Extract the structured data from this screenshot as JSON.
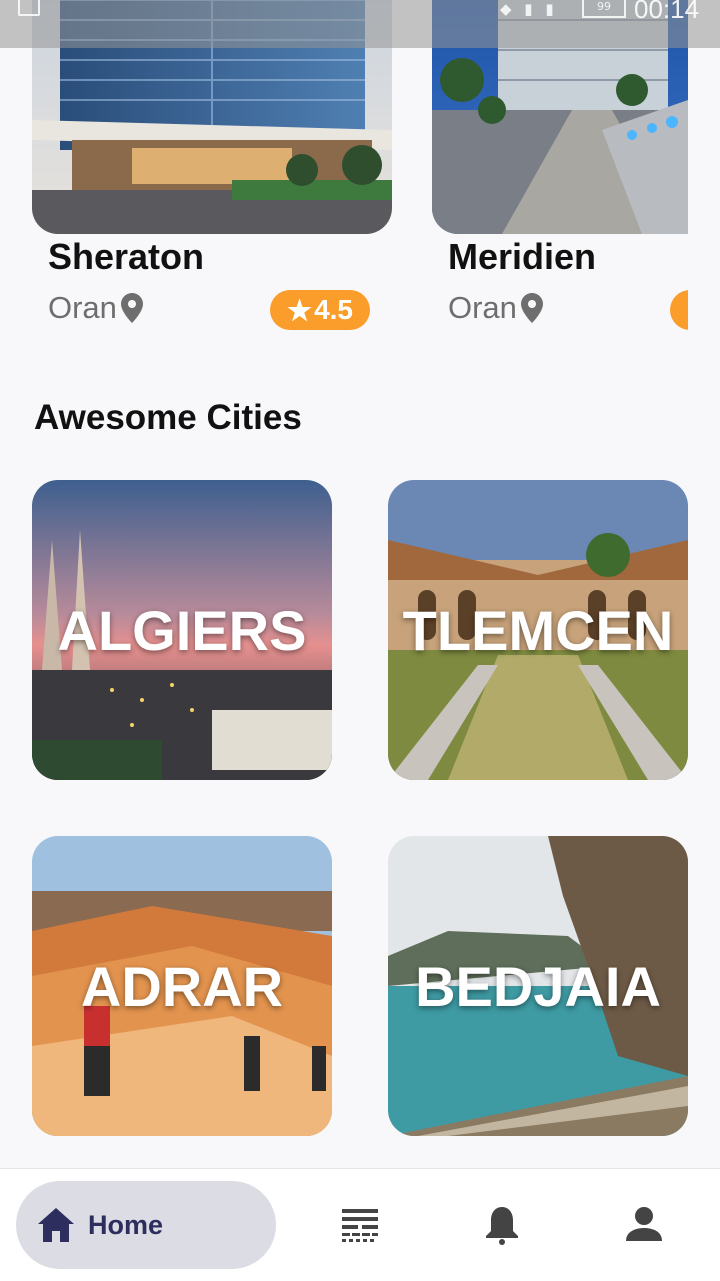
{
  "status_bar": {
    "time": "00:14",
    "battery": "99"
  },
  "hotels": [
    {
      "name": "Sheraton",
      "city": "Oran",
      "rating": "4.5"
    },
    {
      "name": "Meridien",
      "city": "Oran"
    }
  ],
  "section_title": "Awesome Cities",
  "cities": [
    {
      "name": "ALGIERS"
    },
    {
      "name": "TLEMCEN"
    },
    {
      "name": "ADRAR"
    },
    {
      "name": "BEDJAIA"
    }
  ],
  "nav": {
    "home_label": "Home",
    "icons": [
      "home-icon",
      "list-icon",
      "bell-icon",
      "profile-icon"
    ]
  },
  "colors": {
    "accent": "#fb9d2a",
    "nav_active_bg": "#dcdce4",
    "nav_active_text": "#2d2d5e"
  }
}
